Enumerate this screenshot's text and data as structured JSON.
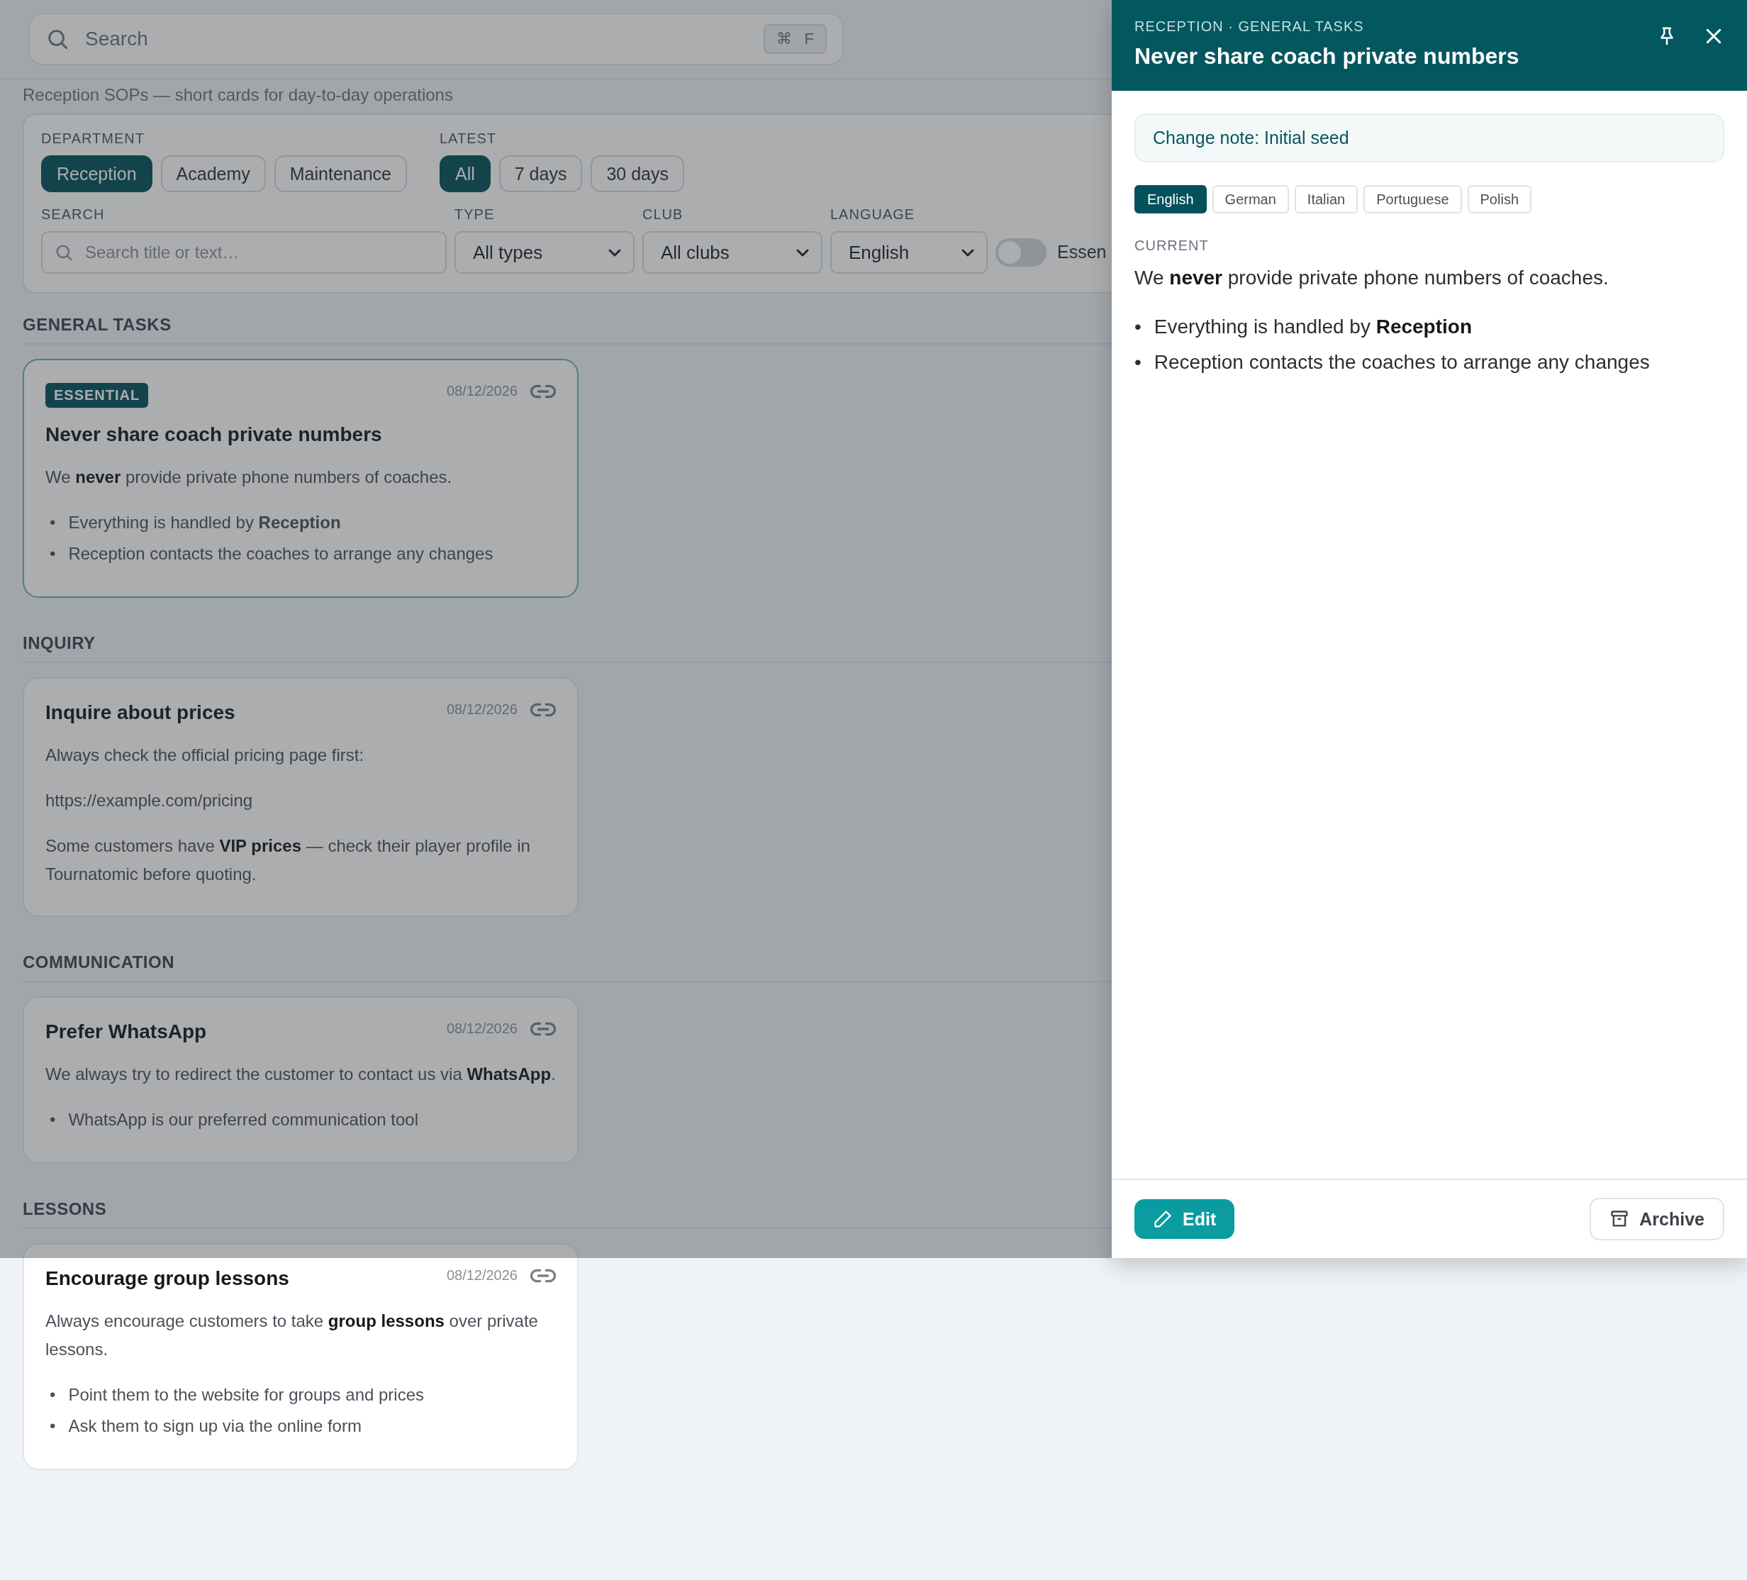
{
  "search": {
    "placeholder": "Search",
    "shortcut": [
      "⌘",
      "F"
    ]
  },
  "subtitle": "Reception SOPs — short cards for day-to-day operations",
  "filters": {
    "groups": [
      {
        "label": "DEPARTMENT",
        "options": [
          {
            "label": "Reception",
            "selected": true
          },
          {
            "label": "Academy",
            "selected": false
          },
          {
            "label": "Maintenance",
            "selected": false
          }
        ]
      },
      {
        "label": "LATEST",
        "options": [
          {
            "label": "All",
            "selected": true
          },
          {
            "label": "7 days",
            "selected": false
          },
          {
            "label": "30 days",
            "selected": false
          }
        ]
      }
    ],
    "search": {
      "label": "SEARCH",
      "placeholder": "Search title or text…"
    },
    "selects": [
      {
        "label": "TYPE",
        "value": "All types"
      },
      {
        "label": "CLUB",
        "value": "All clubs"
      },
      {
        "label": "LANGUAGE",
        "value": "English"
      }
    ],
    "toggle": {
      "label": "Essen",
      "on": false
    }
  },
  "sections": [
    {
      "title": "GENERAL TASKS",
      "cards": [
        {
          "essential": true,
          "badge": "ESSENTIAL",
          "title": "Never share coach private numbers",
          "date": "08/12/2026",
          "paragraphs": [
            "We **never** provide private phone numbers of coaches."
          ],
          "bullets": [
            {
              "marker": "•",
              "text": "Everything is handled by **Reception**"
            },
            {
              "marker": "•",
              "text": "Reception contacts the coaches to arrange any changes"
            }
          ]
        }
      ]
    },
    {
      "title": "INQUIRY",
      "cards": [
        {
          "essential": false,
          "title": "Inquire about prices",
          "date": "08/12/2026",
          "paragraphs": [
            "Always check the official pricing page first:",
            "https://example.com/pricing",
            "Some customers have **VIP prices** — check their player profile in Tournatomic before quoting."
          ]
        }
      ]
    },
    {
      "title": "COMMUNICATION",
      "cards": [
        {
          "essential": false,
          "title": "Prefer WhatsApp",
          "date": "08/12/2026",
          "paragraphs": [
            "We always try to redirect the customer to contact us via **WhatsApp**."
          ],
          "bullets": [
            {
              "marker": "•",
              "text": "WhatsApp is our preferred communication tool"
            }
          ]
        }
      ]
    },
    {
      "title": "LESSONS",
      "cards": [
        {
          "essential": false,
          "title": "Encourage group lessons",
          "date": "08/12/2026",
          "paragraphs": [
            "Always encourage customers to take **group lessons** over private lessons."
          ],
          "bullets": [
            {
              "marker": "•",
              "text": "Point them to the website for groups and prices"
            },
            {
              "marker": "•",
              "text": "Ask them to sign up via the online form"
            }
          ]
        }
      ]
    }
  ],
  "drawer": {
    "breadcrumb": "RECEPTION · GENERAL TASKS",
    "title": "Never share coach private numbers",
    "change_note": "Change note: Initial seed",
    "languages": [
      {
        "label": "English",
        "selected": true
      },
      {
        "label": "German",
        "selected": false
      },
      {
        "label": "Italian",
        "selected": false
      },
      {
        "label": "Portuguese",
        "selected": false
      },
      {
        "label": "Polish",
        "selected": false
      }
    ],
    "section_label": "CURRENT",
    "paragraph": "We **never** provide private phone numbers of coaches.",
    "bullets": [
      {
        "marker": "•",
        "text": "Everything is handled by **Reception**"
      },
      {
        "marker": "•",
        "text": "Reception contacts the coaches to arrange any changes"
      }
    ],
    "edit": "Edit",
    "archive": "Archive"
  }
}
